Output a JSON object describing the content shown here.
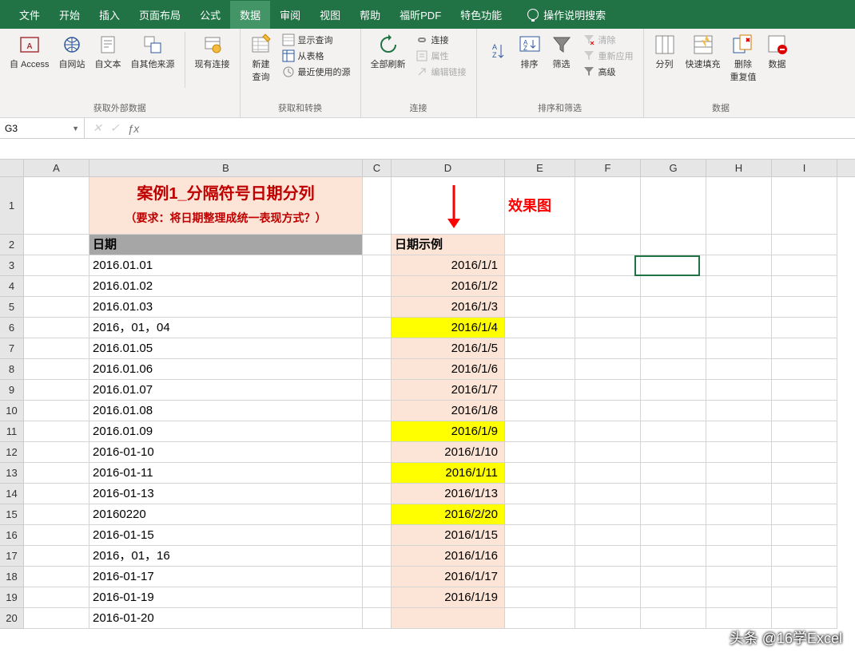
{
  "tabs": [
    "文件",
    "开始",
    "插入",
    "页面布局",
    "公式",
    "数据",
    "审阅",
    "视图",
    "帮助",
    "福昕PDF",
    "特色功能"
  ],
  "active_tab_index": 5,
  "tell_me": "操作说明搜索",
  "ribbon": {
    "g1": {
      "label": "获取外部数据",
      "btns": [
        "自 Access",
        "自网站",
        "自文本",
        "自其他来源",
        "现有连接"
      ]
    },
    "g2": {
      "label": "获取和转换",
      "main": "新建\n查询",
      "opts": [
        "显示查询",
        "从表格",
        "最近使用的源"
      ]
    },
    "g3": {
      "label": "连接",
      "main": "全部刷新",
      "opts": [
        "连接",
        "属性",
        "编辑链接"
      ]
    },
    "g4": {
      "label": "排序和筛选",
      "b1": "排序",
      "b2": "筛选",
      "opts": [
        "清除",
        "重新应用",
        "高级"
      ]
    },
    "g5": {
      "label": "数据",
      "b1": "分列",
      "b2": "快速填充",
      "b3": "删除\n重复值",
      "b4": "数据"
    }
  },
  "namebox": "G3",
  "columns": [
    "A",
    "B",
    "C",
    "D",
    "E",
    "F",
    "G",
    "H",
    "I"
  ],
  "title": {
    "line1": "案例1_分隔符号日期分列",
    "line2": "（要求：将日期整理成统一表现方式？）"
  },
  "effect": "效果图",
  "headers": {
    "b": "日期",
    "d": "日期示例"
  },
  "rows": [
    {
      "n": 3,
      "b": "2016.01.01",
      "d": "2016/1/1",
      "hl": false
    },
    {
      "n": 4,
      "b": "2016.01.02",
      "d": "2016/1/2",
      "hl": false
    },
    {
      "n": 5,
      "b": "2016.01.03",
      "d": "2016/1/3",
      "hl": false
    },
    {
      "n": 6,
      "b": "2016，01，04",
      "d": "2016/1/4",
      "hl": true
    },
    {
      "n": 7,
      "b": "2016.01.05",
      "d": "2016/1/5",
      "hl": false
    },
    {
      "n": 8,
      "b": "2016.01.06",
      "d": "2016/1/6",
      "hl": false
    },
    {
      "n": 9,
      "b": "2016.01.07",
      "d": "2016/1/7",
      "hl": false
    },
    {
      "n": 10,
      "b": "2016.01.08",
      "d": "2016/1/8",
      "hl": false
    },
    {
      "n": 11,
      "b": "2016.01.09",
      "d": "2016/1/9",
      "hl": true
    },
    {
      "n": 12,
      "b": "2016-01-10",
      "d": "2016/1/10",
      "hl": false
    },
    {
      "n": 13,
      "b": "2016-01-11",
      "d": "2016/1/11",
      "hl": true
    },
    {
      "n": 14,
      "b": "2016-01-13",
      "d": "2016/1/13",
      "hl": false
    },
    {
      "n": 15,
      "b": "20160220",
      "d": "2016/2/20",
      "hl": true
    },
    {
      "n": 16,
      "b": "2016-01-15",
      "d": "2016/1/15",
      "hl": false
    },
    {
      "n": 17,
      "b": "2016，01，16",
      "d": "2016/1/16",
      "hl": false
    },
    {
      "n": 18,
      "b": "2016-01-17",
      "d": "2016/1/17",
      "hl": false
    },
    {
      "n": 19,
      "b": "2016-01-19",
      "d": "2016/1/19",
      "hl": false
    },
    {
      "n": 20,
      "b": "2016-01-20",
      "d": "",
      "hl": false
    }
  ],
  "watermark": "头条 @16学Excel"
}
